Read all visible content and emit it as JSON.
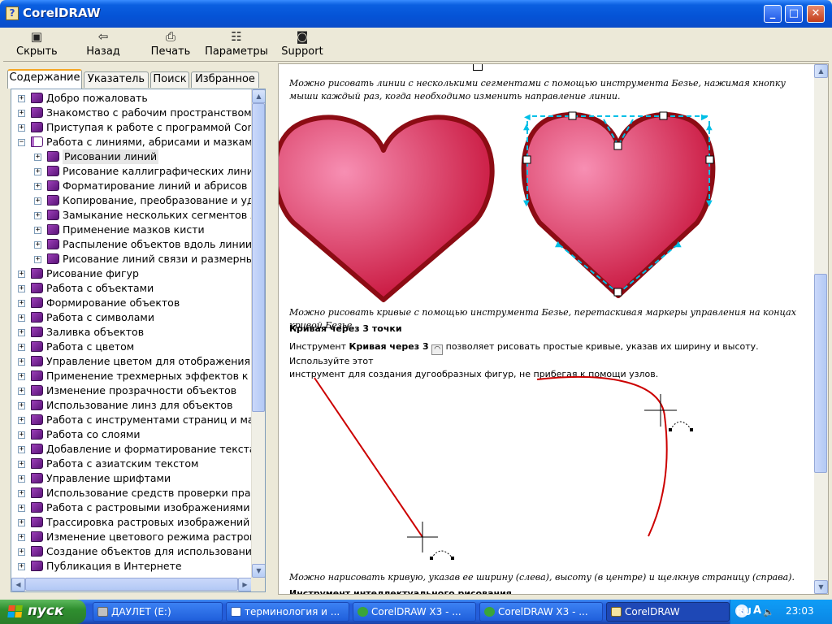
{
  "window": {
    "title": "CorelDRAW",
    "icon": "help-book-icon"
  },
  "toolbar": {
    "hide": "Скрыть",
    "back": "Назад",
    "print": "Печать",
    "options": "Параметры",
    "support": "Support"
  },
  "tabs": [
    {
      "label": "Содержание"
    },
    {
      "label": "Указатель"
    },
    {
      "label": "Поиск"
    },
    {
      "label": "Избранное"
    }
  ],
  "tree": [
    {
      "label": "Добро пожаловать",
      "level": 0,
      "expander": "+",
      "icon": "book-icon"
    },
    {
      "label": "Знакомство с рабочим пространством",
      "level": 0,
      "expander": "+",
      "icon": "book-icon"
    },
    {
      "label": "Приступая к работе с программой CorelD",
      "level": 0,
      "expander": "+",
      "icon": "book-icon"
    },
    {
      "label": "Работа с линиями, абрисами и мазками к",
      "level": 0,
      "expander": "−",
      "icon": "open-book-icon"
    },
    {
      "label": "Рисовании линий",
      "level": 1,
      "expander": "+",
      "icon": "book-icon",
      "selected": true
    },
    {
      "label": "Рисование каллиграфических линий, л",
      "level": 1,
      "expander": "+",
      "icon": "book-icon"
    },
    {
      "label": "Форматирование линий и абрисов",
      "level": 1,
      "expander": "+",
      "icon": "book-icon"
    },
    {
      "label": "Копирование, преобразование и удало",
      "level": 1,
      "expander": "+",
      "icon": "book-icon"
    },
    {
      "label": "Замыкание нескольких сегментов лин",
      "level": 1,
      "expander": "+",
      "icon": "book-icon"
    },
    {
      "label": "Применение мазков кисти",
      "level": 1,
      "expander": "+",
      "icon": "book-icon"
    },
    {
      "label": "Распыление объектов вдоль линии",
      "level": 1,
      "expander": "+",
      "icon": "book-icon"
    },
    {
      "label": "Рисование линий связи и размерных .",
      "level": 1,
      "expander": "+",
      "icon": "book-icon"
    },
    {
      "label": "Рисование фигур",
      "level": 0,
      "expander": "+",
      "icon": "book-icon"
    },
    {
      "label": "Работа с объектами",
      "level": 0,
      "expander": "+",
      "icon": "book-icon"
    },
    {
      "label": "Формирование объектов",
      "level": 0,
      "expander": "+",
      "icon": "book-icon"
    },
    {
      "label": "Работа с символами",
      "level": 0,
      "expander": "+",
      "icon": "book-icon"
    },
    {
      "label": "Заливка объектов",
      "level": 0,
      "expander": "+",
      "icon": "book-icon"
    },
    {
      "label": "Работа с цветом",
      "level": 0,
      "expander": "+",
      "icon": "book-icon"
    },
    {
      "label": "Управление цветом для отображения, вво",
      "level": 0,
      "expander": "+",
      "icon": "book-icon"
    },
    {
      "label": "Применение трехмерных эффектов к объ",
      "level": 0,
      "expander": "+",
      "icon": "book-icon"
    },
    {
      "label": "Изменение прозрачности объектов",
      "level": 0,
      "expander": "+",
      "icon": "book-icon"
    },
    {
      "label": "Использование линз для объектов",
      "level": 0,
      "expander": "+",
      "icon": "book-icon"
    },
    {
      "label": "Работа с инструментами страниц и макет",
      "level": 0,
      "expander": "+",
      "icon": "book-icon"
    },
    {
      "label": "Работа со слоями",
      "level": 0,
      "expander": "+",
      "icon": "book-icon"
    },
    {
      "label": "Добавление и форматирование текста",
      "level": 0,
      "expander": "+",
      "icon": "book-icon"
    },
    {
      "label": "Работа с азиатским текстом",
      "level": 0,
      "expander": "+",
      "icon": "book-icon"
    },
    {
      "label": "Управление шрифтами",
      "level": 0,
      "expander": "+",
      "icon": "book-icon"
    },
    {
      "label": "Использование средств проверки правоп",
      "level": 0,
      "expander": "+",
      "icon": "book-icon"
    },
    {
      "label": "Работа с растровыми изображениями",
      "level": 0,
      "expander": "+",
      "icon": "book-icon"
    },
    {
      "label": "Трассировка растровых изображений и р",
      "level": 0,
      "expander": "+",
      "icon": "book-icon"
    },
    {
      "label": "Изменение цветового режима растровых",
      "level": 0,
      "expander": "+",
      "icon": "book-icon"
    },
    {
      "label": "Создание объектов для использования в",
      "level": 0,
      "expander": "+",
      "icon": "book-icon"
    },
    {
      "label": "Публикация в Интернете",
      "level": 0,
      "expander": "+",
      "icon": "book-icon"
    }
  ],
  "content": {
    "caption1": "Можно рисовать линии с несколькими сегментами с помощью инструмента Безье, нажимая кнопку мыши каждый раз, когда необходимо изменить направление линии.",
    "caption2": "Можно рисовать кривые с помощью инструмента Безье, перетаскивая маркеры управления на концах кривой Безье.",
    "heading1": "Кривая через 3 точки",
    "para_prefix": "Инструмент",
    "para_bold": "Кривая через 3",
    "para_rest1": "позволяет рисовать простые кривые, указав их ширину и высоту. Используйте этот",
    "para_rest2": "инструмент для создания дугообразных фигур, не прибегая к помощи узлов.",
    "caption3": "Можно нарисовать кривую, указав ее ширину (слева), высоту (в центре) и щелкнув страницу (справа).",
    "heading2": "Инструмент интеллектуального рисования"
  },
  "taskbar": {
    "start": "пуск",
    "tasks": [
      {
        "label": "ДАУЛЕТ (E:)",
        "icon": "drive-icon"
      },
      {
        "label": "терминология и ...",
        "icon": "word-doc-icon"
      },
      {
        "label": "CorelDRAW X3 - ...",
        "icon": "coreldraw-icon"
      },
      {
        "label": "CorelDRAW X3 - ...",
        "icon": "coreldraw-icon"
      },
      {
        "label": "CorelDRAW",
        "icon": "help-book-icon",
        "active": true
      }
    ],
    "lang": "RU",
    "clock": "23:03"
  },
  "colors": {
    "heart_light": "#f78fb3",
    "heart_dark": "#c8143c",
    "heart_outline": "#8c0c14",
    "curve": "#cc0000",
    "handles": "#00bfe6"
  }
}
